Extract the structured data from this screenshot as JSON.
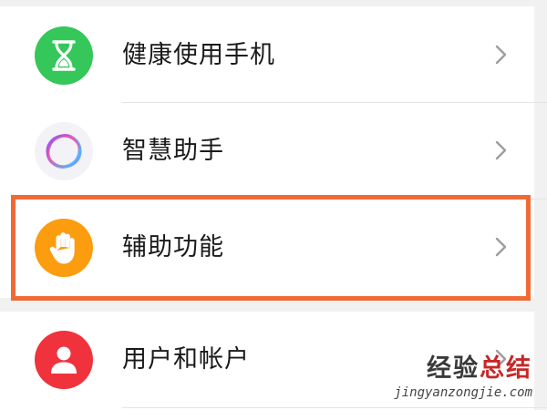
{
  "settings_list": {
    "items": [
      {
        "label": "健康使用手机",
        "icon": "hourglass-icon",
        "icon_bg": "#35c759"
      },
      {
        "label": "智慧助手",
        "icon": "smart-assistant-ring-icon",
        "icon_bg": "#f3f2f6"
      },
      {
        "label": "辅助功能",
        "icon": "hand-icon",
        "icon_bg": "#fb9d0e",
        "highlighted": true
      },
      {
        "label": "用户和帐户",
        "icon": "user-icon",
        "icon_bg": "#f0323c"
      }
    ]
  },
  "highlight": {
    "color": "#f06a36"
  },
  "watermark": {
    "text_part1": "经验",
    "text_part2": "总结",
    "url": "jingyanzongjie.com"
  }
}
